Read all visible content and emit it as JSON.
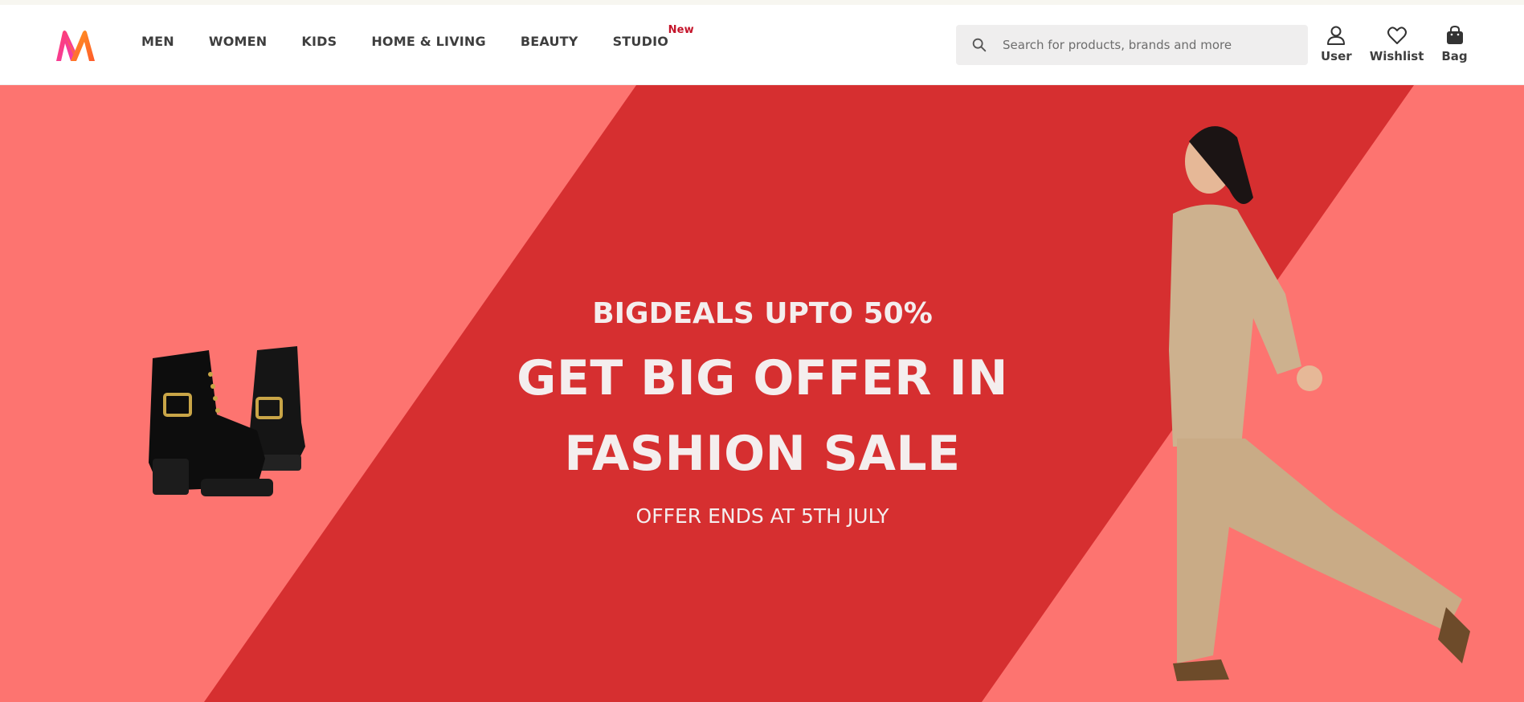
{
  "header": {
    "logo_name": "myntra-logo",
    "menu": [
      {
        "label": "MEN"
      },
      {
        "label": "WOMEN"
      },
      {
        "label": "KIDS"
      },
      {
        "label": "HOME & LIVING"
      },
      {
        "label": "BEAUTY"
      },
      {
        "label": "STUDIO",
        "badge": "New"
      }
    ],
    "search": {
      "placeholder": "Search for products, brands and more",
      "value": ""
    },
    "actions": [
      {
        "label": "User",
        "icon": "user-icon"
      },
      {
        "label": "Wishlist",
        "icon": "heart-icon"
      },
      {
        "label": "Bag",
        "icon": "bag-icon"
      }
    ]
  },
  "hero": {
    "subtitle": "BIGDEALS UPTO 50%",
    "title_line1": "GET BIG OFFER IN",
    "title_line2": "FASHION SALE",
    "footer": "OFFER ENDS AT 5TH JULY",
    "colors": {
      "background": "#fd7470",
      "band": "#d62f30",
      "text": "#f4eeee"
    }
  }
}
